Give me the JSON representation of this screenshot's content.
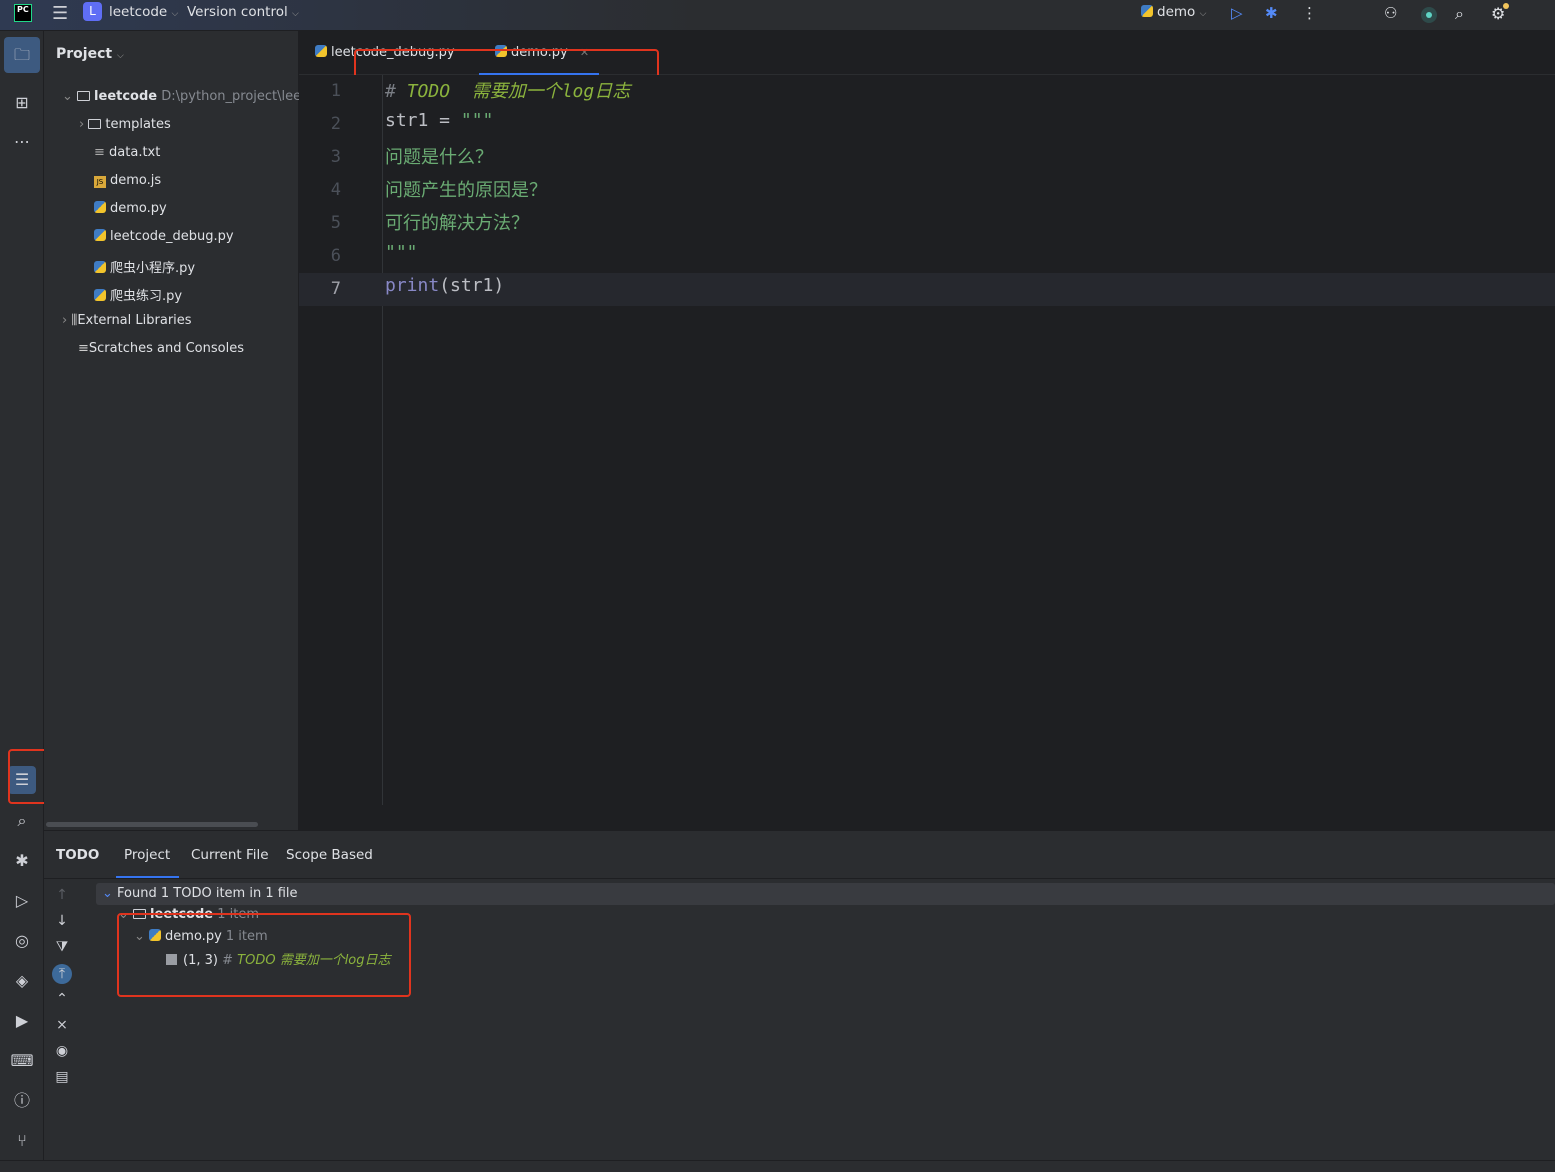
{
  "titlebar": {
    "logo": "PC",
    "project_initial": "L",
    "project": "leetcode",
    "vcs": "Version control",
    "run_config": "demo"
  },
  "project_panel": {
    "title": "Project",
    "root": "leetcode",
    "root_path": "D:\\python_project\\leet",
    "items": [
      "templates",
      "data.txt",
      "demo.js",
      "demo.py",
      "leetcode_debug.py",
      "爬虫小程序.py",
      "爬虫练习.py",
      "External Libraries",
      "Scratches and Consoles"
    ]
  },
  "tabs": [
    {
      "label": "leetcode_debug.py"
    },
    {
      "label": "demo.py",
      "active": true
    }
  ],
  "editor": {
    "lines": [
      {
        "n": "1",
        "parts": [
          [
            "# ",
            "comment"
          ],
          [
            "TODO  需要加一个log日志",
            "todo"
          ]
        ]
      },
      {
        "n": "2",
        "parts": [
          [
            "str1 = ",
            "plain"
          ],
          [
            "\"\"\"",
            "string"
          ]
        ]
      },
      {
        "n": "3",
        "parts": [
          [
            "问题是什么？",
            "string"
          ]
        ]
      },
      {
        "n": "4",
        "parts": [
          [
            "问题产生的原因是？",
            "string"
          ]
        ]
      },
      {
        "n": "5",
        "parts": [
          [
            "可行的解决方法？",
            "string"
          ]
        ]
      },
      {
        "n": "6",
        "parts": [
          [
            "\"\"\"",
            "string"
          ]
        ]
      },
      {
        "n": "7",
        "parts": [
          [
            "print",
            "builtin"
          ],
          [
            "(str1)",
            "plain"
          ]
        ]
      }
    ]
  },
  "todo": {
    "title": "TODO",
    "tabs": [
      "Project",
      "Current File",
      "Scope Based"
    ],
    "summary": "Found 1 TODO item in 1 file",
    "root": "leetcode",
    "root_count": "1 item",
    "file": "demo.py",
    "file_count": "1 item",
    "entry_pos": "(1, 3)",
    "entry_hash": "#",
    "entry_text": "TODO 需要加一个log日志"
  },
  "colors": {
    "accent": "#3574f0",
    "todo": "#8bb33d",
    "string": "#6aab73",
    "annotation": "#e0341e"
  }
}
